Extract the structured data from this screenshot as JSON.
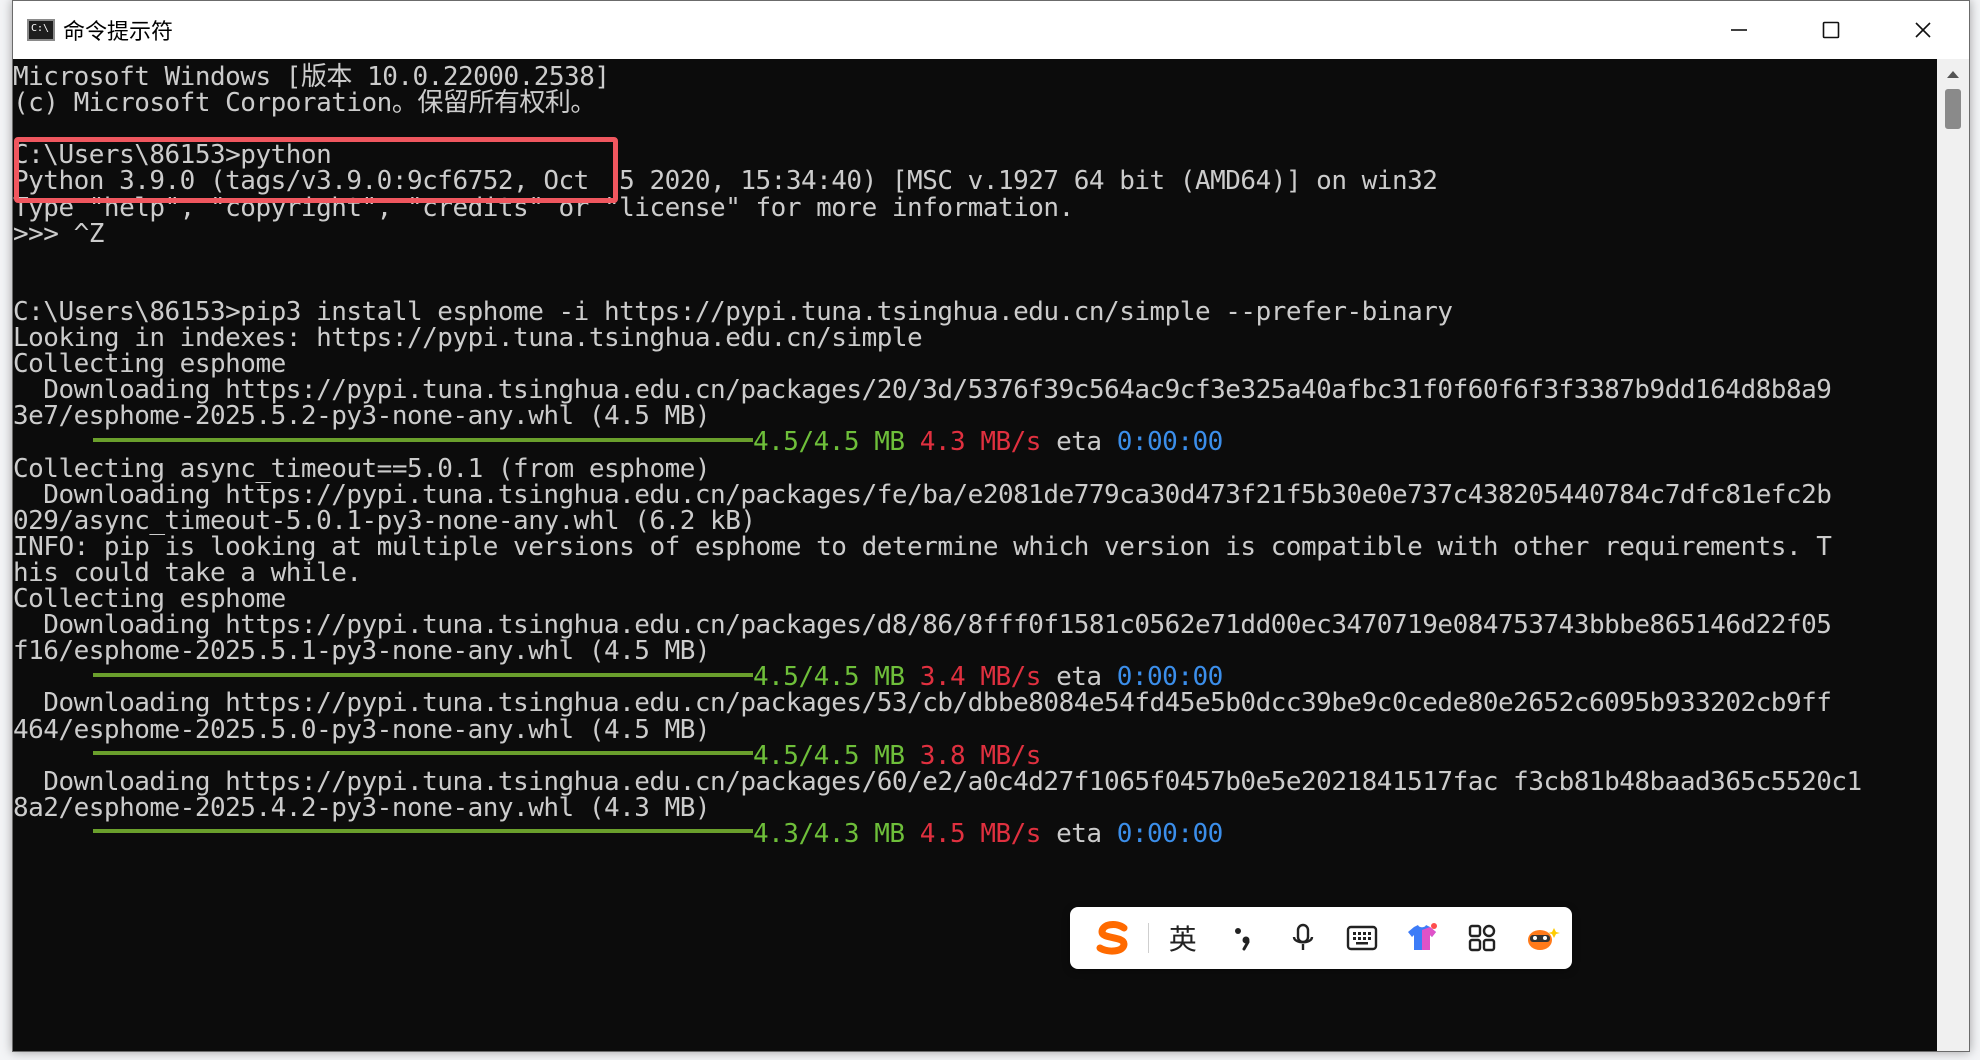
{
  "window": {
    "title": "命令提示符",
    "icon": "cmd-icon",
    "controls": [
      "minimize-icon",
      "maximize-icon",
      "close-icon"
    ]
  },
  "console": {
    "lines": [
      {
        "text": "Microsoft Windows [版本 10.0.22000.2538]"
      },
      {
        "text": "(c) Microsoft Corporation。保留所有权利。"
      },
      {
        "text": ""
      },
      {
        "text": "C:\\Users\\86153>python"
      },
      {
        "text": "Python 3.9.0 (tags/v3.9.0:9cf6752, Oct  5 2020, 15:34:40) [MSC v.1927 64 bit (AMD64)] on win32"
      },
      {
        "text": "Type \"help\", \"copyright\", \"credits\" or \"license\" for more information."
      },
      {
        "text": ">>> ^Z"
      },
      {
        "text": ""
      },
      {
        "text": ""
      },
      {
        "text": "C:\\Users\\86153>pip3 install esphome -i https://pypi.tuna.tsinghua.edu.cn/simple --prefer-binary"
      },
      {
        "text": "Looking in indexes: https://pypi.tuna.tsinghua.edu.cn/simple"
      },
      {
        "text": "Collecting esphome"
      },
      {
        "text": "  Downloading https://pypi.tuna.tsinghua.edu.cn/packages/20/3d/5376f39c564ac9cf3e325a40afbc31f0f60f6f3f3387b9dd164d8b8a9"
      },
      {
        "text": "3e7/esphome-2025.5.2-py3-none-any.whl (4.5 MB)"
      },
      {
        "progress": {
          "size": "4.5/4.5 MB",
          "speed": "4.3 MB/s",
          "eta_label": "eta",
          "eta": "0:00:00"
        }
      },
      {
        "text": "Collecting async_timeout==5.0.1 (from esphome)"
      },
      {
        "text": "  Downloading https://pypi.tuna.tsinghua.edu.cn/packages/fe/ba/e2081de779ca30d473f21f5b30e0e737c438205440784c7dfc81efc2b"
      },
      {
        "text": "029/async_timeout-5.0.1-py3-none-any.whl (6.2 kB)"
      },
      {
        "text": "INFO: pip is looking at multiple versions of esphome to determine which version is compatible with other requirements. T"
      },
      {
        "text": "his could take a while."
      },
      {
        "text": "Collecting esphome"
      },
      {
        "text": "  Downloading https://pypi.tuna.tsinghua.edu.cn/packages/d8/86/8fff0f1581c0562e71dd00ec3470719e084753743bbbe865146d22f05"
      },
      {
        "text": "f16/esphome-2025.5.1-py3-none-any.whl (4.5 MB)"
      },
      {
        "progress": {
          "size": "4.5/4.5 MB",
          "speed": "3.4 MB/s",
          "eta_label": "eta",
          "eta": "0:00:00"
        }
      },
      {
        "text": "  Downloading https://pypi.tuna.tsinghua.edu.cn/packages/53/cb/dbbe8084e54fd45e5b0dcc39be9c0cede80e2652c6095b933202cb9ff"
      },
      {
        "text": "464/esphome-2025.5.0-py3-none-any.whl (4.5 MB)"
      },
      {
        "progress": {
          "size": "4.5/4.5 MB",
          "speed": "3.8 MB/s",
          "eta_label": "",
          "eta": ""
        }
      },
      {
        "text": "  Downloading https://pypi.tuna.tsinghua.edu.cn/packages/60/e2/a0c4d27f1065f0457b0e5e2021841517fac f3cb81b48baad365c5520c1"
      },
      {
        "text": "8a2/esphome-2025.4.2-py3-none-any.whl (4.3 MB)"
      },
      {
        "progress": {
          "size": "4.3/4.3 MB",
          "speed": "4.5 MB/s",
          "eta_label": "eta",
          "eta": "0:00:00"
        }
      }
    ]
  },
  "ime_toolbar": {
    "logo": "sogou-s-logo-icon",
    "lang_label": "英",
    "items": [
      "punctuation-icon",
      "microphone-icon",
      "keyboard-icon",
      "skin-shirt-icon",
      "toolbox-grid-icon",
      "mascot-icon"
    ],
    "colors": {
      "logo": "#ff6a00",
      "shirt_a": "#3d7cf7",
      "shirt_b": "#e052c8"
    }
  },
  "colors": {
    "progress_green": "#6ebf3a",
    "speed_red": "#e0303f",
    "eta_blue": "#3b8eea",
    "highlight_box": "#f0575f"
  }
}
